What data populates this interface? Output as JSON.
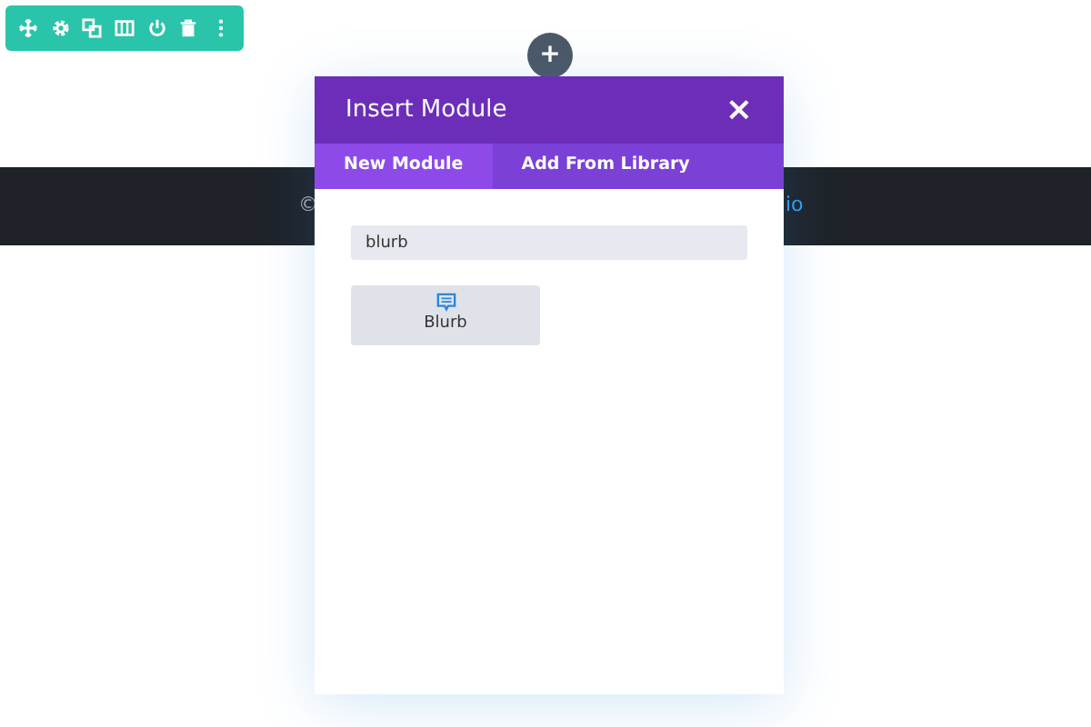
{
  "toolbar": {
    "icons": [
      {
        "kind": "move"
      },
      {
        "kind": "settings"
      },
      {
        "kind": "duplicate"
      },
      {
        "kind": "columns"
      },
      {
        "kind": "save"
      },
      {
        "kind": "delete"
      },
      {
        "kind": "more"
      }
    ]
  },
  "add_button": {
    "label": "+"
  },
  "footer": {
    "left_text": "©",
    "right_link": "io"
  },
  "modal": {
    "title": "Insert Module",
    "close": "×",
    "tabs": [
      {
        "label": "New Module",
        "selected": true
      },
      {
        "label": "Add From Library",
        "selected": false
      }
    ],
    "search": {
      "value": "blurb"
    },
    "modules": [
      {
        "label": "Blurb",
        "kind": "blurb"
      }
    ]
  }
}
